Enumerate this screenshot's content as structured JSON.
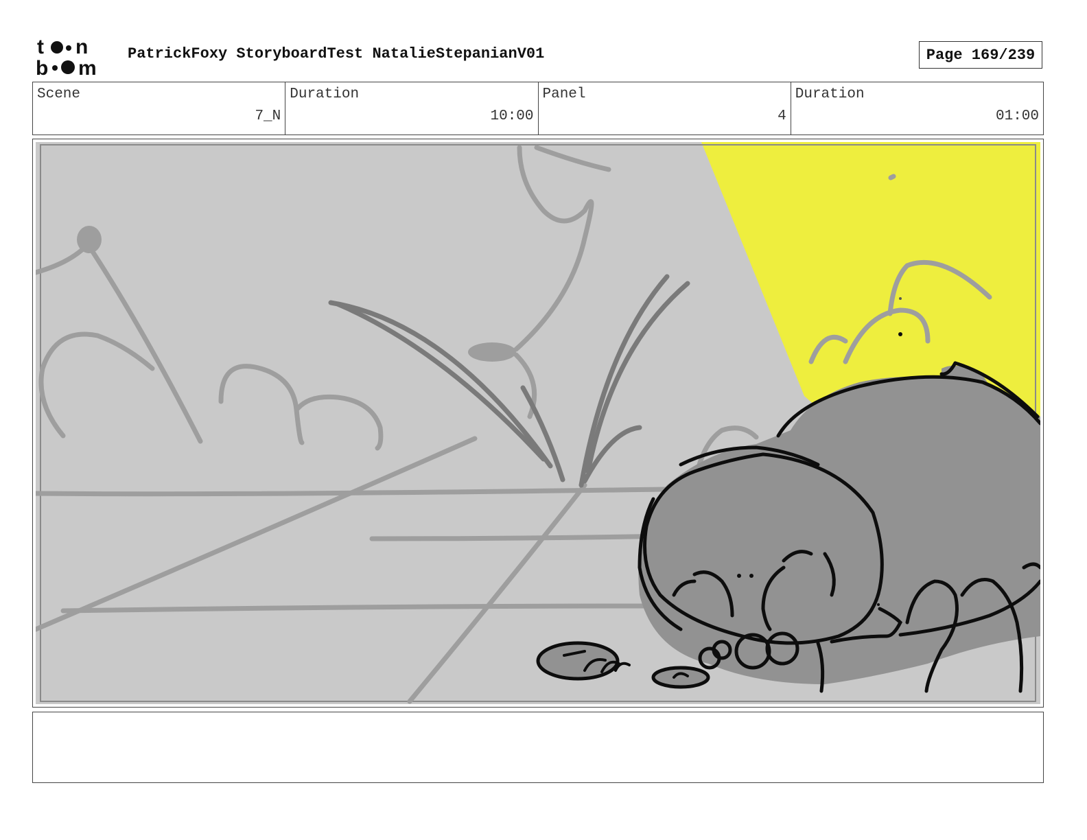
{
  "header": {
    "logo_text_top": "toon",
    "logo_text_bottom": "boom",
    "title": "PatrickFoxy StoryboardTest NatalieStepanianV01",
    "page": "Page 169/239"
  },
  "info": [
    {
      "label": "Scene",
      "value": "7_N"
    },
    {
      "label": "Duration",
      "value": "10:00"
    },
    {
      "label": "Panel",
      "value": "4"
    },
    {
      "label": "Duration",
      "value": "01:00"
    }
  ],
  "colors": {
    "panel_background": "#c9c9c9",
    "spotlight": "#eeee3e",
    "character_fill": "#929292",
    "sketch_line": "#9d9d9d",
    "ink": "#0d0d0d"
  },
  "notes": ""
}
